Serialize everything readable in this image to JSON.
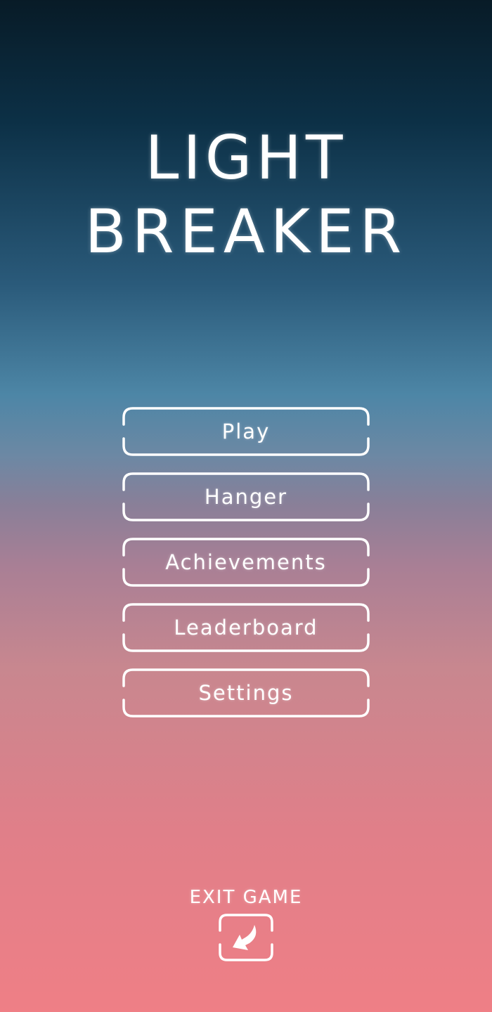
{
  "title": {
    "line1": "LIGHT",
    "line2": "BREAKER"
  },
  "menu": {
    "items": [
      {
        "id": "play",
        "label": "Play"
      },
      {
        "id": "hanger",
        "label": "Hanger"
      },
      {
        "id": "achievements",
        "label": "Achievements"
      },
      {
        "id": "leaderboard",
        "label": "Leaderboard"
      },
      {
        "id": "settings",
        "label": "Settings"
      }
    ]
  },
  "exit": {
    "label": "EXIT GAME",
    "icon": "back-arrow-icon"
  },
  "colors": {
    "text": "#ffffff",
    "frame": "#ffffff",
    "bg_top": "#081b27",
    "bg_mid": "#4d86a6",
    "bg_bottom": "#ef7f86"
  }
}
